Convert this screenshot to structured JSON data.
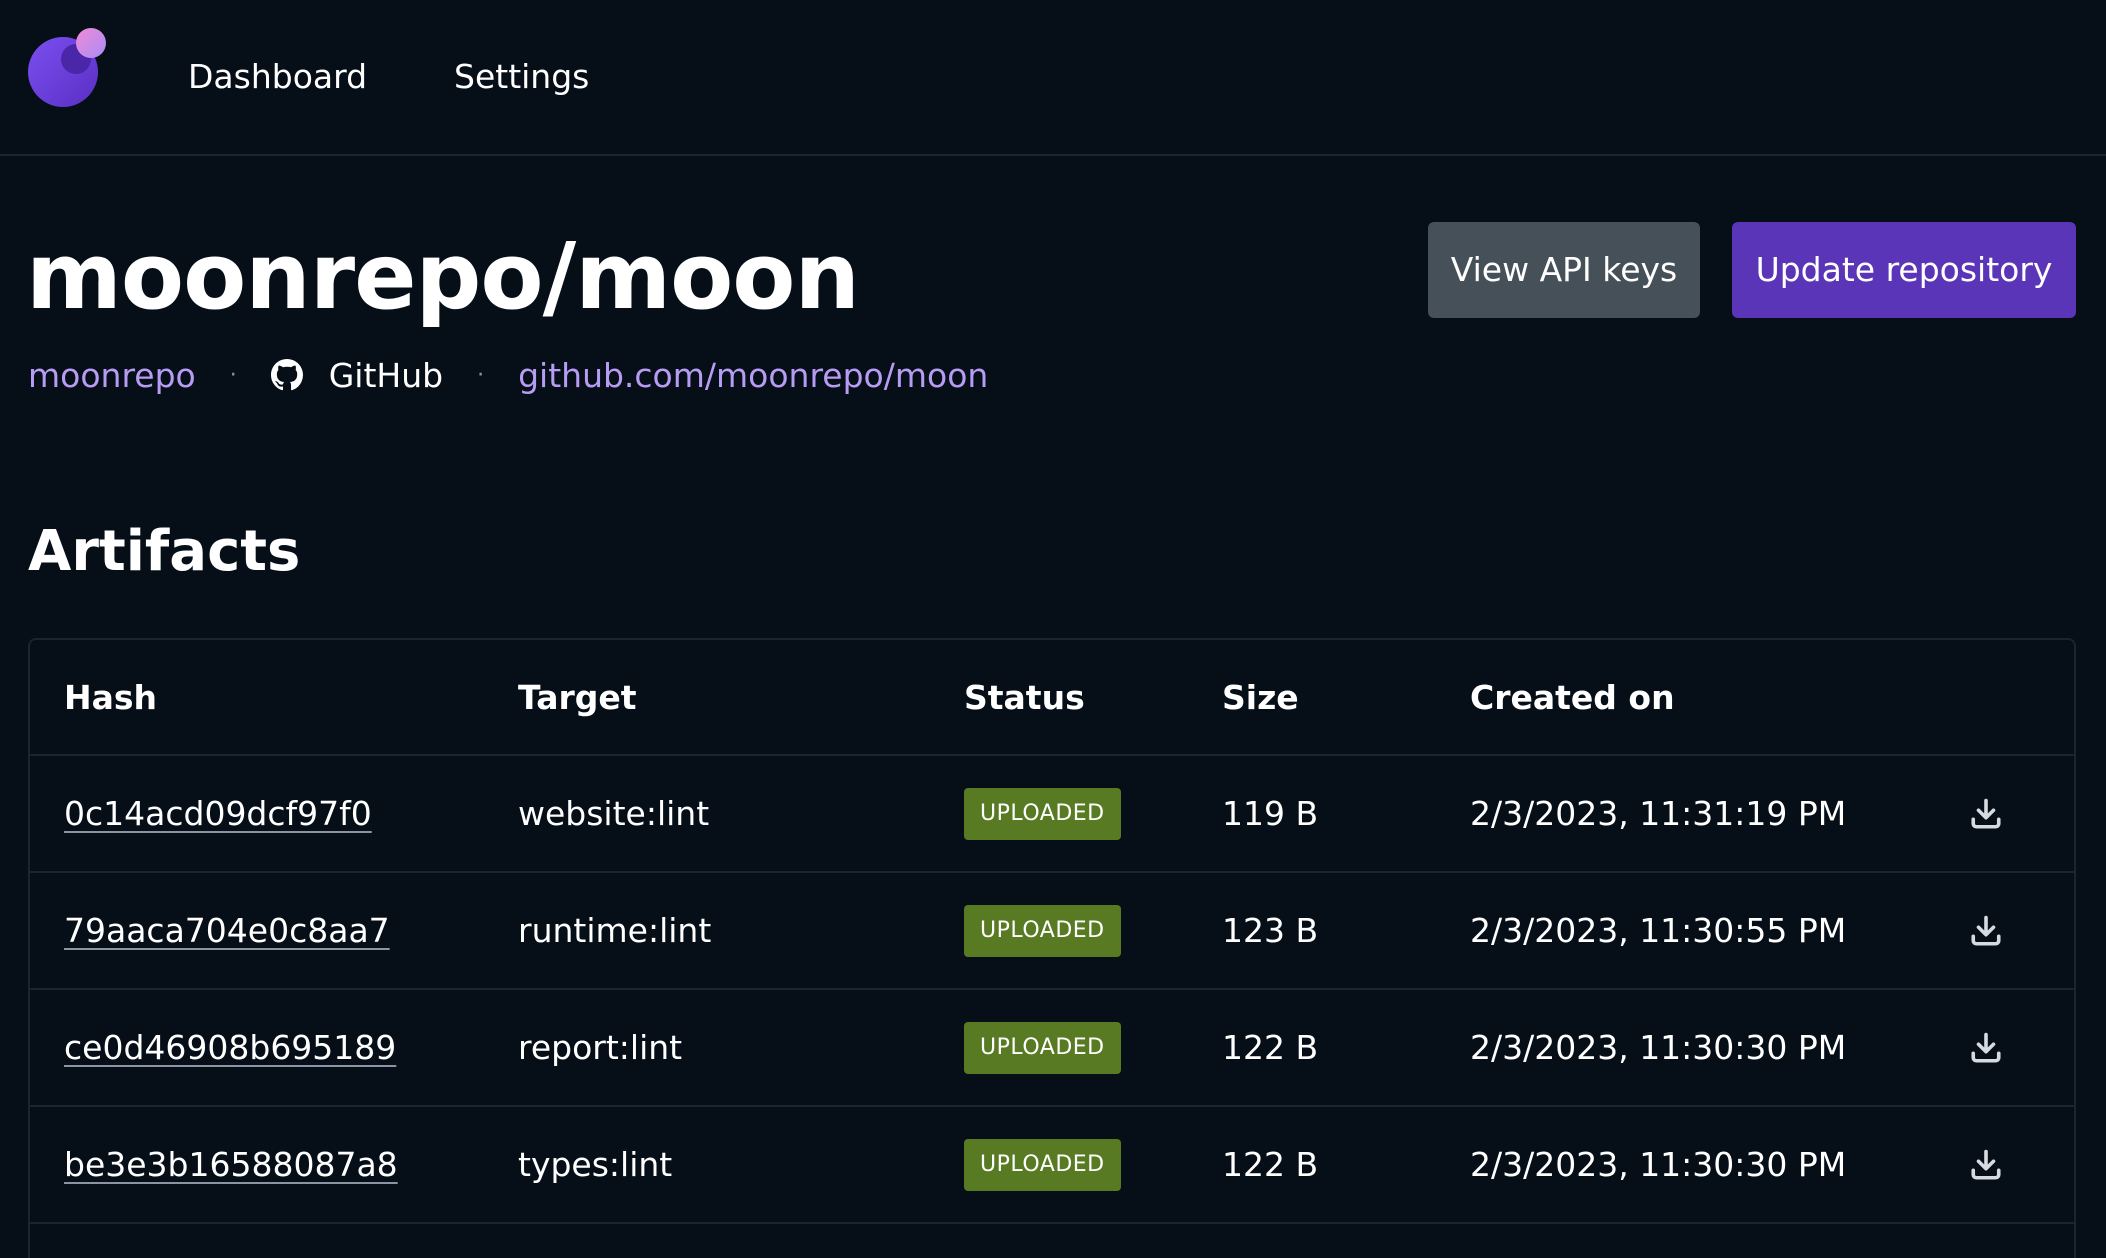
{
  "nav": {
    "items": [
      {
        "label": "Dashboard"
      },
      {
        "label": "Settings"
      }
    ]
  },
  "repo": {
    "title": "moonrepo/moon",
    "owner": "moonrepo",
    "provider": "GitHub",
    "url": "github.com/moonrepo/moon",
    "separator": "·"
  },
  "actions": {
    "view_api_keys": "View API keys",
    "update_repository": "Update repository"
  },
  "colors": {
    "background": "#060e18",
    "accent": "#5a35b8",
    "link": "#b79cf3",
    "secondary_button": "#465058",
    "status_uploaded": "#577a23",
    "border": "#1b2430"
  },
  "artifacts": {
    "title": "Artifacts",
    "columns": {
      "hash": "Hash",
      "target": "Target",
      "status": "Status",
      "size": "Size",
      "created": "Created on"
    },
    "rows": [
      {
        "hash": "0c14acd09dcf97f0",
        "target": "website:lint",
        "status": "UPLOADED",
        "size": "119 B",
        "created": "2/3/2023, 11:31:19 PM",
        "action_icon": "download-icon"
      },
      {
        "hash": "79aaca704e0c8aa7",
        "target": "runtime:lint",
        "status": "UPLOADED",
        "size": "123 B",
        "created": "2/3/2023, 11:30:55 PM",
        "action_icon": "download-icon"
      },
      {
        "hash": "ce0d46908b695189",
        "target": "report:lint",
        "status": "UPLOADED",
        "size": "122 B",
        "created": "2/3/2023, 11:30:30 PM",
        "action_icon": "download-icon"
      },
      {
        "hash": "be3e3b16588087a8",
        "target": "types:lint",
        "status": "UPLOADED",
        "size": "122 B",
        "created": "2/3/2023, 11:30:30 PM",
        "action_icon": "download-icon"
      }
    ]
  }
}
